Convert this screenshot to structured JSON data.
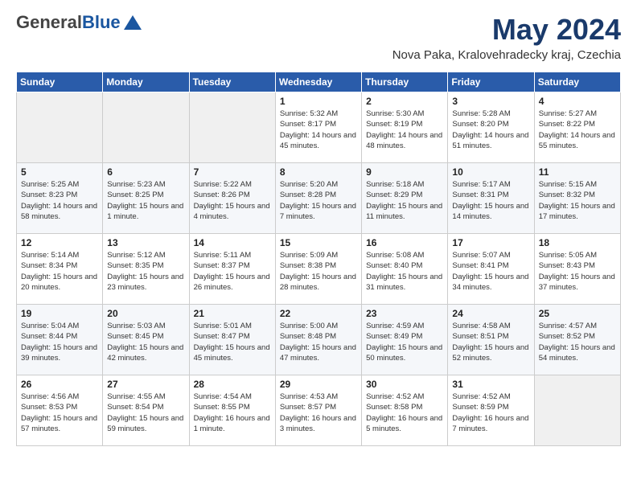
{
  "logo": {
    "general": "General",
    "blue": "Blue"
  },
  "header": {
    "month": "May 2024",
    "location": "Nova Paka, Kralovehradecky kraj, Czechia"
  },
  "weekdays": [
    "Sunday",
    "Monday",
    "Tuesday",
    "Wednesday",
    "Thursday",
    "Friday",
    "Saturday"
  ],
  "weeks": [
    [
      {
        "day": "",
        "sunrise": "",
        "sunset": "",
        "daylight": ""
      },
      {
        "day": "",
        "sunrise": "",
        "sunset": "",
        "daylight": ""
      },
      {
        "day": "",
        "sunrise": "",
        "sunset": "",
        "daylight": ""
      },
      {
        "day": "1",
        "sunrise": "Sunrise: 5:32 AM",
        "sunset": "Sunset: 8:17 PM",
        "daylight": "Daylight: 14 hours and 45 minutes."
      },
      {
        "day": "2",
        "sunrise": "Sunrise: 5:30 AM",
        "sunset": "Sunset: 8:19 PM",
        "daylight": "Daylight: 14 hours and 48 minutes."
      },
      {
        "day": "3",
        "sunrise": "Sunrise: 5:28 AM",
        "sunset": "Sunset: 8:20 PM",
        "daylight": "Daylight: 14 hours and 51 minutes."
      },
      {
        "day": "4",
        "sunrise": "Sunrise: 5:27 AM",
        "sunset": "Sunset: 8:22 PM",
        "daylight": "Daylight: 14 hours and 55 minutes."
      }
    ],
    [
      {
        "day": "5",
        "sunrise": "Sunrise: 5:25 AM",
        "sunset": "Sunset: 8:23 PM",
        "daylight": "Daylight: 14 hours and 58 minutes."
      },
      {
        "day": "6",
        "sunrise": "Sunrise: 5:23 AM",
        "sunset": "Sunset: 8:25 PM",
        "daylight": "Daylight: 15 hours and 1 minute."
      },
      {
        "day": "7",
        "sunrise": "Sunrise: 5:22 AM",
        "sunset": "Sunset: 8:26 PM",
        "daylight": "Daylight: 15 hours and 4 minutes."
      },
      {
        "day": "8",
        "sunrise": "Sunrise: 5:20 AM",
        "sunset": "Sunset: 8:28 PM",
        "daylight": "Daylight: 15 hours and 7 minutes."
      },
      {
        "day": "9",
        "sunrise": "Sunrise: 5:18 AM",
        "sunset": "Sunset: 8:29 PM",
        "daylight": "Daylight: 15 hours and 11 minutes."
      },
      {
        "day": "10",
        "sunrise": "Sunrise: 5:17 AM",
        "sunset": "Sunset: 8:31 PM",
        "daylight": "Daylight: 15 hours and 14 minutes."
      },
      {
        "day": "11",
        "sunrise": "Sunrise: 5:15 AM",
        "sunset": "Sunset: 8:32 PM",
        "daylight": "Daylight: 15 hours and 17 minutes."
      }
    ],
    [
      {
        "day": "12",
        "sunrise": "Sunrise: 5:14 AM",
        "sunset": "Sunset: 8:34 PM",
        "daylight": "Daylight: 15 hours and 20 minutes."
      },
      {
        "day": "13",
        "sunrise": "Sunrise: 5:12 AM",
        "sunset": "Sunset: 8:35 PM",
        "daylight": "Daylight: 15 hours and 23 minutes."
      },
      {
        "day": "14",
        "sunrise": "Sunrise: 5:11 AM",
        "sunset": "Sunset: 8:37 PM",
        "daylight": "Daylight: 15 hours and 26 minutes."
      },
      {
        "day": "15",
        "sunrise": "Sunrise: 5:09 AM",
        "sunset": "Sunset: 8:38 PM",
        "daylight": "Daylight: 15 hours and 28 minutes."
      },
      {
        "day": "16",
        "sunrise": "Sunrise: 5:08 AM",
        "sunset": "Sunset: 8:40 PM",
        "daylight": "Daylight: 15 hours and 31 minutes."
      },
      {
        "day": "17",
        "sunrise": "Sunrise: 5:07 AM",
        "sunset": "Sunset: 8:41 PM",
        "daylight": "Daylight: 15 hours and 34 minutes."
      },
      {
        "day": "18",
        "sunrise": "Sunrise: 5:05 AM",
        "sunset": "Sunset: 8:43 PM",
        "daylight": "Daylight: 15 hours and 37 minutes."
      }
    ],
    [
      {
        "day": "19",
        "sunrise": "Sunrise: 5:04 AM",
        "sunset": "Sunset: 8:44 PM",
        "daylight": "Daylight: 15 hours and 39 minutes."
      },
      {
        "day": "20",
        "sunrise": "Sunrise: 5:03 AM",
        "sunset": "Sunset: 8:45 PM",
        "daylight": "Daylight: 15 hours and 42 minutes."
      },
      {
        "day": "21",
        "sunrise": "Sunrise: 5:01 AM",
        "sunset": "Sunset: 8:47 PM",
        "daylight": "Daylight: 15 hours and 45 minutes."
      },
      {
        "day": "22",
        "sunrise": "Sunrise: 5:00 AM",
        "sunset": "Sunset: 8:48 PM",
        "daylight": "Daylight: 15 hours and 47 minutes."
      },
      {
        "day": "23",
        "sunrise": "Sunrise: 4:59 AM",
        "sunset": "Sunset: 8:49 PM",
        "daylight": "Daylight: 15 hours and 50 minutes."
      },
      {
        "day": "24",
        "sunrise": "Sunrise: 4:58 AM",
        "sunset": "Sunset: 8:51 PM",
        "daylight": "Daylight: 15 hours and 52 minutes."
      },
      {
        "day": "25",
        "sunrise": "Sunrise: 4:57 AM",
        "sunset": "Sunset: 8:52 PM",
        "daylight": "Daylight: 15 hours and 54 minutes."
      }
    ],
    [
      {
        "day": "26",
        "sunrise": "Sunrise: 4:56 AM",
        "sunset": "Sunset: 8:53 PM",
        "daylight": "Daylight: 15 hours and 57 minutes."
      },
      {
        "day": "27",
        "sunrise": "Sunrise: 4:55 AM",
        "sunset": "Sunset: 8:54 PM",
        "daylight": "Daylight: 15 hours and 59 minutes."
      },
      {
        "day": "28",
        "sunrise": "Sunrise: 4:54 AM",
        "sunset": "Sunset: 8:55 PM",
        "daylight": "Daylight: 16 hours and 1 minute."
      },
      {
        "day": "29",
        "sunrise": "Sunrise: 4:53 AM",
        "sunset": "Sunset: 8:57 PM",
        "daylight": "Daylight: 16 hours and 3 minutes."
      },
      {
        "day": "30",
        "sunrise": "Sunrise: 4:52 AM",
        "sunset": "Sunset: 8:58 PM",
        "daylight": "Daylight: 16 hours and 5 minutes."
      },
      {
        "day": "31",
        "sunrise": "Sunrise: 4:52 AM",
        "sunset": "Sunset: 8:59 PM",
        "daylight": "Daylight: 16 hours and 7 minutes."
      },
      {
        "day": "",
        "sunrise": "",
        "sunset": "",
        "daylight": ""
      }
    ]
  ]
}
